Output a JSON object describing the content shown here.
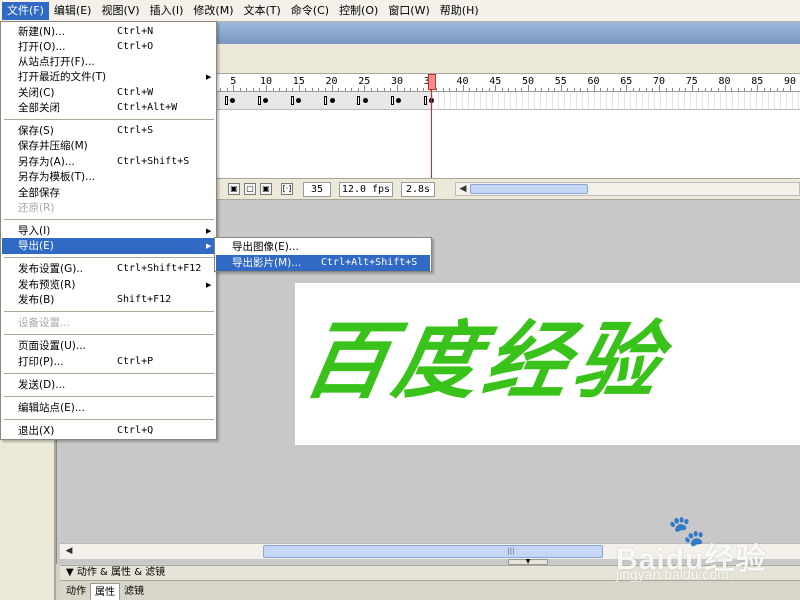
{
  "menubar": {
    "items": [
      {
        "label": "文件(F)"
      },
      {
        "label": "编辑(E)"
      },
      {
        "label": "视图(V)"
      },
      {
        "label": "插入(I)"
      },
      {
        "label": "修改(M)"
      },
      {
        "label": "文本(T)"
      },
      {
        "label": "命令(C)"
      },
      {
        "label": "控制(O)"
      },
      {
        "label": "窗口(W)"
      },
      {
        "label": "帮助(H)"
      }
    ]
  },
  "file_menu": {
    "items": [
      {
        "label": "新建(N)...",
        "shortcut": "Ctrl+N"
      },
      {
        "label": "打开(O)...",
        "shortcut": "Ctrl+O"
      },
      {
        "label": "从站点打开(F)...",
        "shortcut": ""
      },
      {
        "label": "打开最近的文件(T)",
        "shortcut": ""
      },
      {
        "label": "关闭(C)",
        "shortcut": "Ctrl+W"
      },
      {
        "label": "全部关闭",
        "shortcut": "Ctrl+Alt+W"
      },
      {
        "label": "保存(S)",
        "shortcut": "Ctrl+S"
      },
      {
        "label": "保存并压缩(M)",
        "shortcut": ""
      },
      {
        "label": "另存为(A)...",
        "shortcut": "Ctrl+Shift+S"
      },
      {
        "label": "另存为模板(T)...",
        "shortcut": ""
      },
      {
        "label": "全部保存",
        "shortcut": ""
      },
      {
        "label": "还原(R)",
        "shortcut": ""
      },
      {
        "label": "导入(I)",
        "shortcut": ""
      },
      {
        "label": "导出(E)",
        "shortcut": ""
      },
      {
        "label": "发布设置(G)..",
        "shortcut": "Ctrl+Shift+F12"
      },
      {
        "label": "发布预览(R)",
        "shortcut": ""
      },
      {
        "label": "发布(B)",
        "shortcut": "Shift+F12"
      },
      {
        "label": "设备设置...",
        "shortcut": ""
      },
      {
        "label": "页面设置(U)...",
        "shortcut": ""
      },
      {
        "label": "打印(P)...",
        "shortcut": "Ctrl+P"
      },
      {
        "label": "发送(D)...",
        "shortcut": ""
      },
      {
        "label": "编辑站点(E)...",
        "shortcut": ""
      },
      {
        "label": "退出(X)",
        "shortcut": "Ctrl+Q"
      }
    ]
  },
  "export_submenu": {
    "items": [
      {
        "label": "导出图像(E)...",
        "shortcut": ""
      },
      {
        "label": "导出影片(M)...",
        "shortcut": "Ctrl+Alt+Shift+S"
      }
    ]
  },
  "timeline": {
    "ruler_ticks": [
      "5",
      "10",
      "15",
      "20",
      "25",
      "30",
      "35",
      "40",
      "45",
      "50",
      "55",
      "60",
      "65",
      "70",
      "75",
      "80",
      "85",
      "90"
    ],
    "current_frame": "35",
    "frame_rate": "12.0 fps",
    "elapsed_time": "2.8s"
  },
  "stage": {
    "text": "百度经验",
    "text_color": "#39c21a"
  },
  "properties_panel": {
    "header": "▼ 动作 & 属性 & 滤镜",
    "tabs": [
      {
        "label": "动作",
        "selected": false
      },
      {
        "label": "属性",
        "selected": true
      },
      {
        "label": "滤镜",
        "selected": false
      }
    ]
  },
  "watermark": {
    "logo": "Baidu经验",
    "url": "jingyan.baidu.com"
  },
  "colors": {
    "menu_highlight": "#316ac5",
    "playhead": "#d22222"
  }
}
